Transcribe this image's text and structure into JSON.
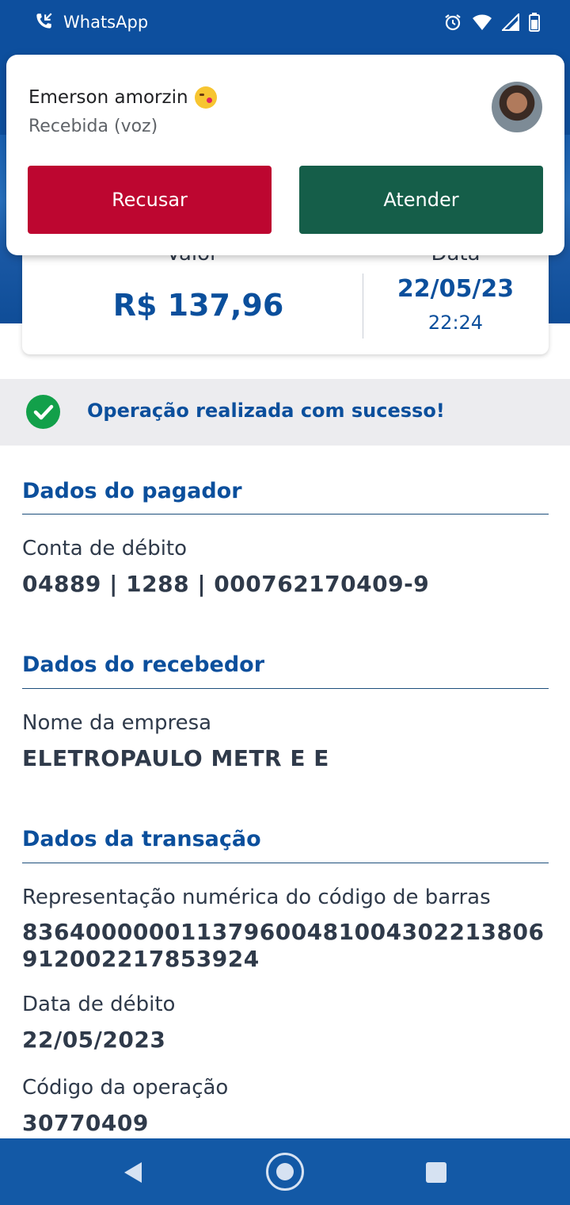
{
  "status_bar": {
    "app_name": "WhatsApp",
    "icons": [
      "missed-call-icon",
      "alarm-icon",
      "wifi-icon",
      "signal-icon",
      "battery-icon"
    ]
  },
  "notification": {
    "caller_name": "Emerson amorzin",
    "emoji": "kissing-face-emoji",
    "subtitle": "Recebida (voz)",
    "decline_label": "Recusar",
    "accept_label": "Atender",
    "decline_color": "#bd0630",
    "accept_color": "#155e49"
  },
  "summary": {
    "valor_label": "Valor",
    "data_label": "Data",
    "amount": "R$ 137,96",
    "date": "22/05/23",
    "time": "22:24"
  },
  "success_message": "Operação realizada com sucesso!",
  "pagador": {
    "title": "Dados do pagador",
    "account_label": "Conta de débito",
    "account_value": "04889 | 1288 | 000762170409-9"
  },
  "recebedor": {
    "title": "Dados do recebedor",
    "company_label": "Nome da empresa",
    "company_value": "ELETROPAULO METR E E"
  },
  "transacao": {
    "title": "Dados da transação",
    "barcode_label": "Representação numérica do código de barras",
    "barcode_value": "836400000011379600481004302213806912002217853924",
    "debit_date_label": "Data de débito",
    "debit_date_value": "22/05/2023",
    "op_code_label": "Código da operação",
    "op_code_value": "30770409"
  },
  "colors": {
    "brand_blue": "#0b4f9c",
    "success_green": "#12a04a"
  }
}
